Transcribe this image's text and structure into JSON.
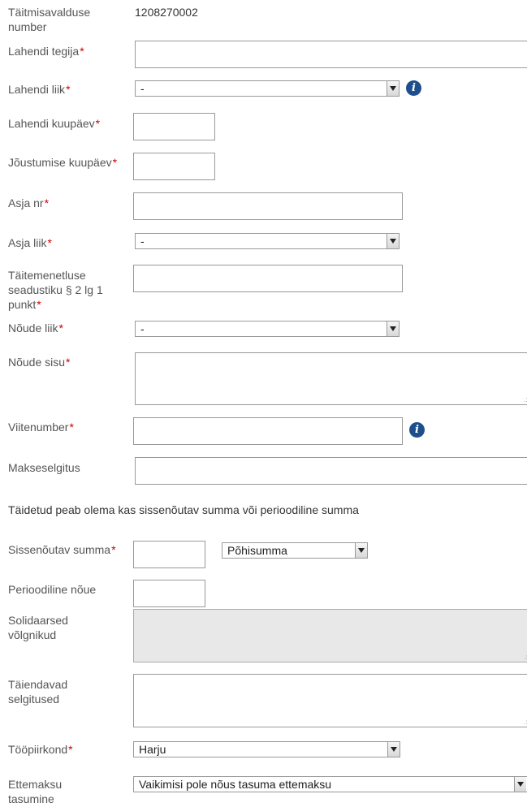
{
  "application_number": {
    "label": "Täitmisavalduse number",
    "value": "1208270002"
  },
  "decision_maker": {
    "label": "Lahendi tegija",
    "value": ""
  },
  "decision_type": {
    "label": "Lahendi liik",
    "selected": "-",
    "info_icon": "info-icon"
  },
  "decision_date": {
    "label": "Lahendi kuupäev",
    "value": ""
  },
  "effective_date": {
    "label": "Jõustumise kuupäev",
    "value": ""
  },
  "case_number": {
    "label": "Asja nr",
    "value": ""
  },
  "case_type": {
    "label": "Asja liik",
    "selected": "-"
  },
  "enforcement_act_point": {
    "label": "Täitemenetluse seadustiku § 2 lg 1 punkt",
    "value": ""
  },
  "claim_type": {
    "label": "Nõude liik",
    "selected": "-"
  },
  "claim_content": {
    "label": "Nõude sisu",
    "value": ""
  },
  "reference_number": {
    "label": "Viitenumber",
    "value": "",
    "info_icon": "info-icon"
  },
  "payment_description": {
    "label": "Makseselgitus",
    "value": ""
  },
  "note": "Täidetud peab olema kas sissenõutav summa või perioodiline summa",
  "claimed_amount": {
    "label": "Sissenõutav summa",
    "value": "",
    "amount_type_selected": "Põhisumma"
  },
  "periodic_claim": {
    "label": "Perioodiline nõue",
    "value": ""
  },
  "joint_debtors": {
    "label": "Solidaarsed võlgnikud",
    "value": ""
  },
  "additional_explanations": {
    "label": "Täiendavad selgitused",
    "value": ""
  },
  "work_district": {
    "label": "Tööpiirkond",
    "selected": "Harju"
  },
  "prepayment": {
    "label": "Ettemaksu tasumine",
    "selected": "Vaikimisi pole nõus tasuma ettemaksu"
  },
  "colors": {
    "required_marker": "#cc0000",
    "info_icon": "#1f4e8c",
    "label_text": "#555555",
    "disabled_bg": "#e8e8e8"
  }
}
